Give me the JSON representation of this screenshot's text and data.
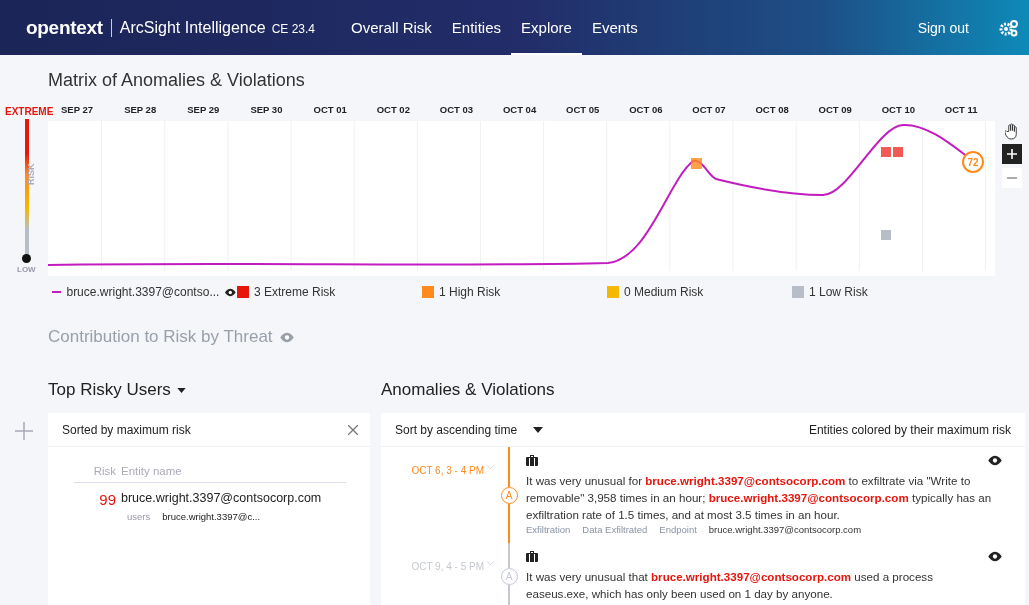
{
  "header": {
    "logo": "opentext",
    "product": "ArcSight Intelligence",
    "version": "CE 23.4",
    "tabs": [
      {
        "label": "Overall Risk",
        "selected": false
      },
      {
        "label": "Entities",
        "selected": false
      },
      {
        "label": "Explore",
        "selected": true
      },
      {
        "label": "Events",
        "selected": false
      }
    ],
    "sign_out": "Sign out"
  },
  "matrix": {
    "title": "Matrix of Anomalies & Violations",
    "risk_top": "EXTREME",
    "risk_axis": "RISK",
    "risk_bottom": "LOW",
    "dates": [
      "SEP 27",
      "SEP 28",
      "SEP 29",
      "SEP 30",
      "OCT 01",
      "OCT 02",
      "OCT 03",
      "OCT 04",
      "OCT 05",
      "OCT 06",
      "OCT 07",
      "OCT 08",
      "OCT 09",
      "OCT 10",
      "OCT 11"
    ],
    "score_badge": "72",
    "legend": [
      {
        "kind": "line",
        "label": "bruce.wright.3397@contso...",
        "color": "#c21cc0"
      },
      {
        "kind": "square",
        "label": "3 Extreme Risk",
        "color": "#e8150d"
      },
      {
        "kind": "square",
        "label": "1 High Risk",
        "color": "#ff8a1c"
      },
      {
        "kind": "square",
        "label": "0 Medium Risk",
        "color": "#f5b800"
      },
      {
        "kind": "square",
        "label": "1 Low Risk",
        "color": "#b8bec8"
      }
    ]
  },
  "contribution": {
    "title": "Contribution to Risk by Threat"
  },
  "top_users": {
    "title": "Top Risky Users",
    "sort_label": "Sorted by maximum risk",
    "columns": [
      "Risk",
      "Entity name"
    ],
    "rows": [
      {
        "risk": "99",
        "name": "bruce.wright.3397@contsocorp.com",
        "type": "users",
        "short_name": "bruce.wright.3397@c..."
      }
    ]
  },
  "anomalies": {
    "title": "Anomalies & Violations",
    "sort": "Sort by ascending time",
    "note": "Entities colored by their maximum risk",
    "events": [
      {
        "time": "OCT 6, 3 - 4 PM",
        "badge": "A",
        "selected": true,
        "text": "It was very unusual for **bruce.wright.3397@contsocorp.com** to exfiltrate via \"Write to removable\" 3,958 times in an hour; **bruce.wright.3397@contsocorp.com** typically has an exfiltration rate of 1.5 times, and at most 3.5 times in an hour.",
        "tags": [
          "Exfiltration",
          "Data Exfiltrated",
          "Endpoint"
        ],
        "entity": "bruce.wright.3397@contsocorp.com"
      },
      {
        "time": "OCT 9, 4 - 5 PM",
        "badge": "A",
        "selected": false,
        "text": "It was very unusual that **bruce.wright.3397@contsocorp.com** used a process easeus.exe, which has only been used on 1 day by anyone."
      }
    ]
  }
}
